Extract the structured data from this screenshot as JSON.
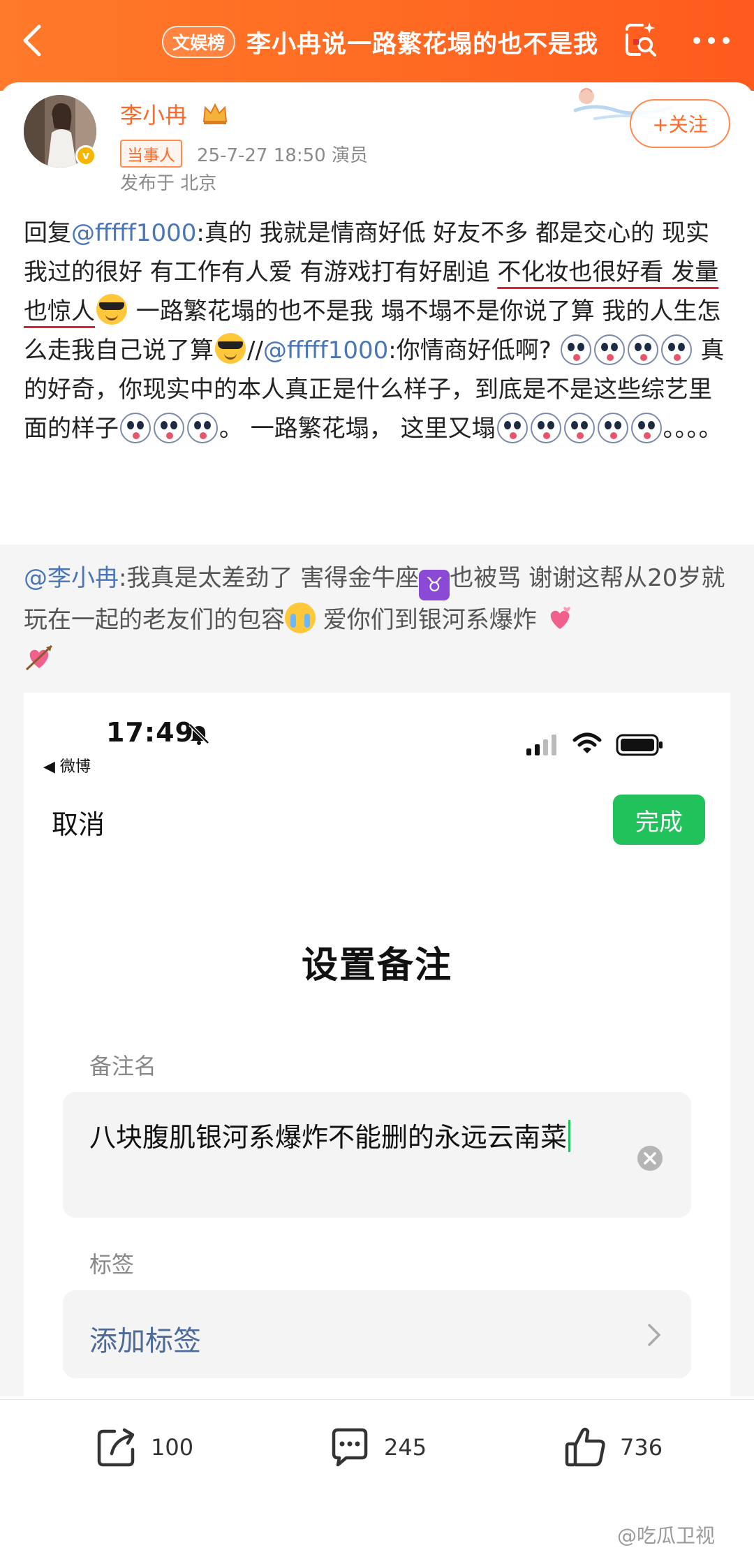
{
  "header": {
    "badge": "文娱榜",
    "title": "李小冉说一路繁花塌的也不是我"
  },
  "author": {
    "name": "李小冉",
    "role_badge": "当事人",
    "meta": "25-7-27 18:50  演员",
    "location": "发布于 北京",
    "follow_label": "+关注",
    "verified_mark": "v"
  },
  "post": {
    "p1": "回复",
    "mention1": "@fffff1000",
    "p2": ":真的 我就是情商好低 好友不多 都是交心的 现实我过的很好 有工作有人爱 有游戏打有好剧追 ",
    "underlined": "不化妆也很好看 发量也惊人",
    "p3": " 一路繁花塌的也不是我 塌不塌不是你说了算 我的人生怎么走我自己说了算",
    "p4": "//",
    "mention2": "@fffff1000",
    "p5": ":你情商好低啊? ",
    "p6": "  真的好奇，你现实中的本人真正是什么样子，到底是不是这些综艺里面的样子",
    "p7": "。 一路繁花塌， 这里又塌",
    "p8": "。。。。"
  },
  "repost": {
    "mention": "@李小冉",
    "t1": ":我真是太差劲了 害得金牛座",
    "taurus": "♉",
    "t2": "也被骂 谢谢这帮从20岁就玩在一起的老友们的包容",
    "t3": " 爱你们到银河系爆炸 "
  },
  "embedded": {
    "time": "17:49",
    "back_app": "◀ 微博",
    "cancel": "取消",
    "done": "完成",
    "title": "设置备注",
    "name_label": "备注名",
    "name_value": "八块腹肌银河系爆炸不能删的永远云南菜",
    "tag_label": "标签",
    "tag_action": "添加标签"
  },
  "actions": {
    "share_count": "100",
    "comment_count": "245",
    "like_count": "736"
  },
  "watermark": "@吃瓜卫视",
  "colors": {
    "header_gradient_start": "#ff7a2a",
    "header_gradient_end": "#ff5a1e",
    "mention_blue": "#4a76b8",
    "done_green": "#21c25c",
    "brand_orange": "#ff6a2b"
  }
}
